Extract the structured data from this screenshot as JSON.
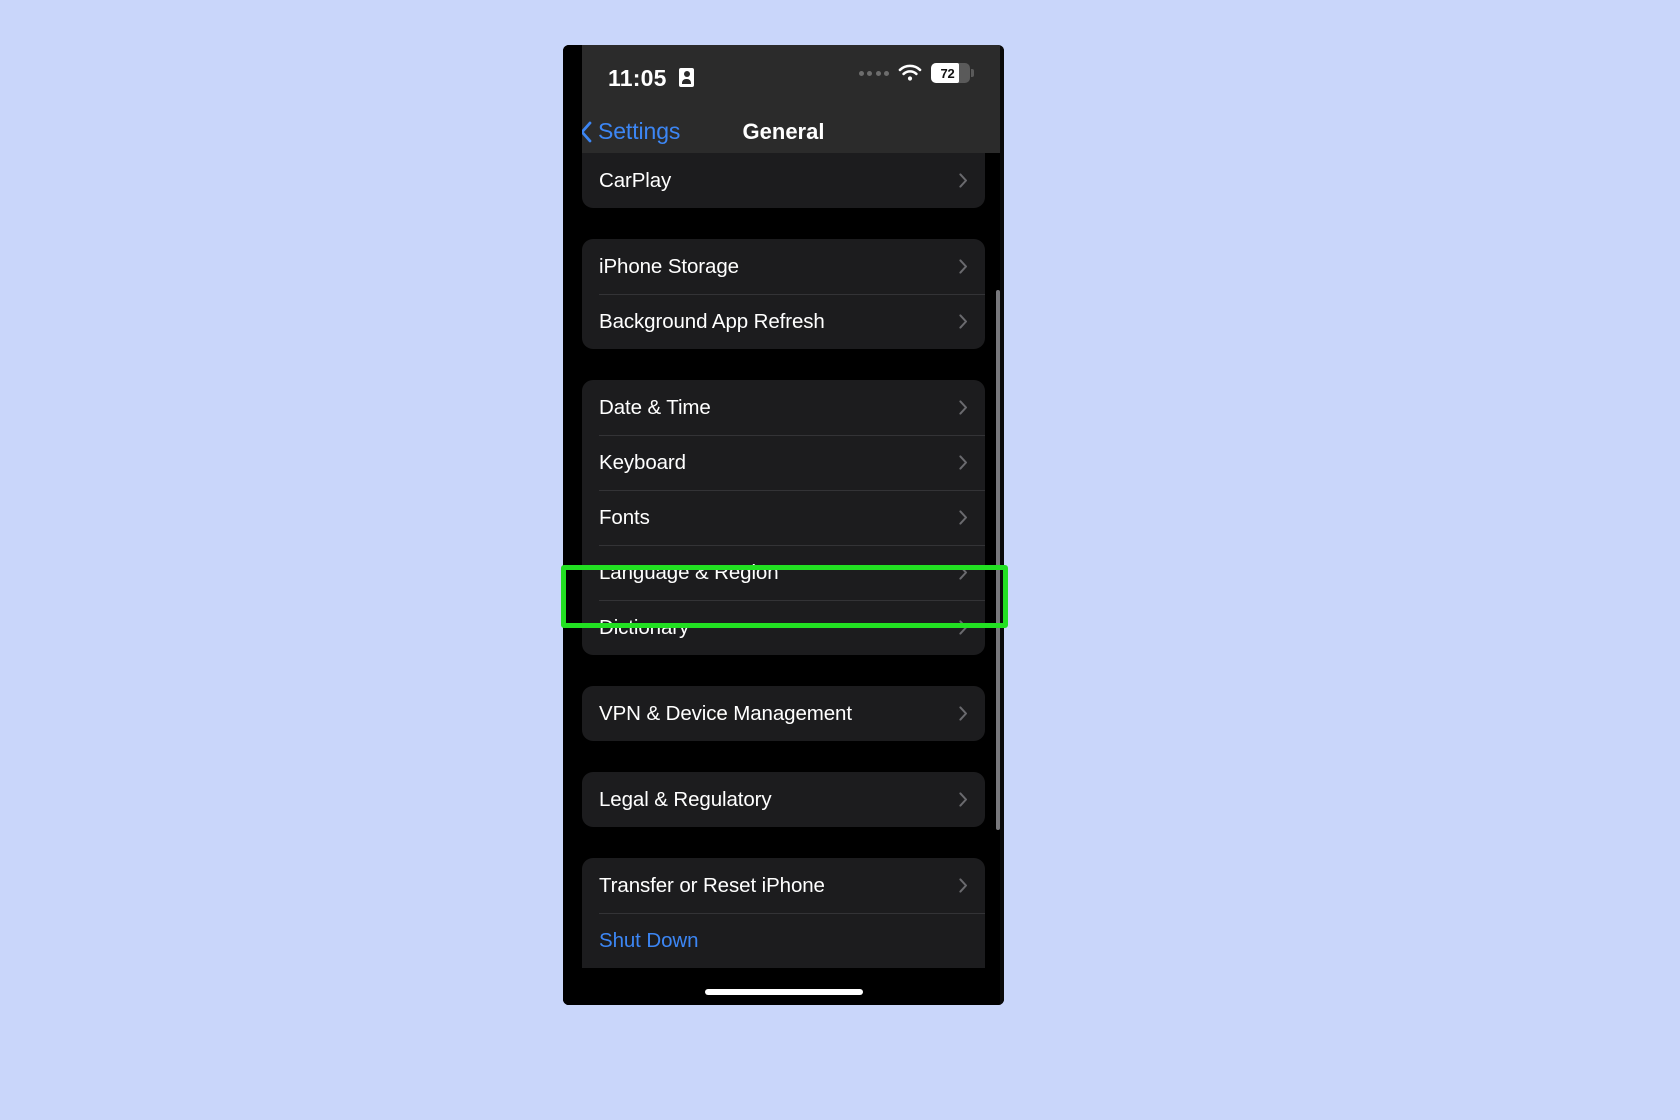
{
  "background_color": "#c9d6fa",
  "device": {
    "frame_color": "#000000",
    "chrome_color": "#2b2b2b"
  },
  "status_bar": {
    "time": "11:05",
    "lock_icon": "id-badge-icon",
    "signal_icon": "signal-dots-icon",
    "wifi_icon": "wifi-icon",
    "battery_percent": "72",
    "battery_level_fraction": 0.72
  },
  "nav_bar": {
    "back_label": "Settings",
    "back_icon": "chevron-left-icon",
    "title": "General"
  },
  "groups": [
    {
      "name": "carplay-group",
      "clip": "top",
      "rows": [
        {
          "label": "CarPlay",
          "accessory": "chevron-right-icon",
          "style": "default"
        }
      ]
    },
    {
      "name": "storage-group",
      "clip": "none",
      "rows": [
        {
          "label": "iPhone Storage",
          "accessory": "chevron-right-icon",
          "style": "default"
        },
        {
          "label": "Background App Refresh",
          "accessory": "chevron-right-icon",
          "style": "default"
        }
      ]
    },
    {
      "name": "localization-group",
      "clip": "none",
      "rows": [
        {
          "label": "Date & Time",
          "accessory": "chevron-right-icon",
          "style": "default"
        },
        {
          "label": "Keyboard",
          "accessory": "chevron-right-icon",
          "style": "default"
        },
        {
          "label": "Fonts",
          "accessory": "chevron-right-icon",
          "style": "default"
        },
        {
          "label": "Language & Region",
          "accessory": "chevron-right-icon",
          "style": "default"
        },
        {
          "label": "Dictionary",
          "accessory": "chevron-right-icon",
          "style": "default"
        }
      ]
    },
    {
      "name": "vpn-group",
      "clip": "none",
      "rows": [
        {
          "label": "VPN & Device Management",
          "accessory": "chevron-right-icon",
          "style": "default"
        }
      ]
    },
    {
      "name": "legal-group",
      "clip": "none",
      "rows": [
        {
          "label": "Legal & Regulatory",
          "accessory": "chevron-right-icon",
          "style": "default"
        }
      ]
    },
    {
      "name": "reset-group",
      "clip": "bottom",
      "rows": [
        {
          "label": "Transfer or Reset iPhone",
          "accessory": "chevron-right-icon",
          "style": "default"
        },
        {
          "label": "Shut Down",
          "accessory": "none",
          "style": "blue"
        }
      ]
    }
  ],
  "annotation": {
    "type": "highlight-rectangle",
    "target_row_label": "Language & Region",
    "color": "#22e022"
  },
  "scroll_indicator": {
    "visible": true,
    "color": "#8d8d92"
  },
  "home_indicator": {
    "visible": true,
    "color": "#ffffff"
  }
}
